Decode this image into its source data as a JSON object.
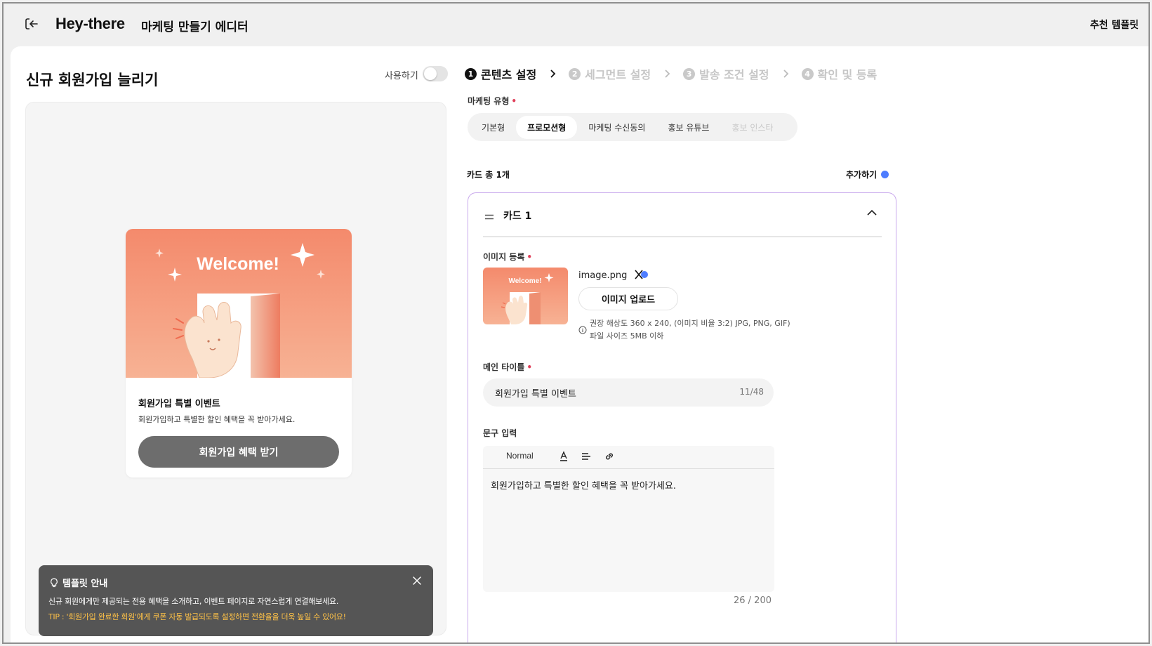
{
  "header": {
    "brand": "Hey-there",
    "subtitle": "마케팅 만들기 에디터",
    "recommended_templates": "추천 템플릿"
  },
  "campaign": {
    "title": "신규 회원가입 늘리기",
    "use_label": "사용하기",
    "enabled": false
  },
  "preview": {
    "banner_text": "Welcome!",
    "card_title": "회원가입 특별 이벤트",
    "card_body": "회원가입하고 특별한 할인 혜택을 꼭 받아가세요.",
    "cta": "회원가입 혜택 받기"
  },
  "guide": {
    "title": "템플릿 안내",
    "text": "신규 회원에게만 제공되는 전용 혜택을 소개하고, 이벤트 페이지로 자연스럽게 연결해보세요.",
    "tip": "TIP : '회원가입 완료한 회원'에게 쿠폰 자동 발급되도록 설정하면 전환율을 더욱 높일 수 있어요!"
  },
  "steps": [
    {
      "num": "1",
      "label": "콘텐츠 설정",
      "active": true
    },
    {
      "num": "2",
      "label": "세그먼트 설정",
      "active": false
    },
    {
      "num": "3",
      "label": "발송 조건 설정",
      "active": false
    },
    {
      "num": "4",
      "label": "확인 및 등록",
      "active": false
    }
  ],
  "marketing_type": {
    "label": "마케팅 유형",
    "required_mark": "•",
    "tabs": [
      "기본형",
      "프로모션형",
      "마케팅 수신동의",
      "홍보 유튜브",
      "홍보 인스타"
    ],
    "selected": "프로모션형"
  },
  "cards": {
    "count_label": "카드 총 1개",
    "add_label": "추가하기"
  },
  "card_editor": {
    "title": "카드 1",
    "image_label": "이미지 등록",
    "file_name": "image.png",
    "upload_button": "이미지 업로드",
    "hint_resolution": "권장 해상도 360 x 240, (이미지 비율 3:2) JPG, PNG, GIF)",
    "hint_size": "파일 사이즈 5MB 이하",
    "main_title_label": "메인 타이틀",
    "main_title_value": "회원가입 특별 이벤트",
    "main_title_count": "11/48",
    "copy_label": "문구 입력",
    "toolbar_format": "Normal",
    "copy_value": "회원가입하고 특별한 할인 혜택을 꼭 받아가세요.",
    "copy_count": "26 / 200"
  },
  "colors": {
    "accent_blue": "#4e7dff",
    "card_border": "#c8a8ec",
    "required_red": "#e0405a",
    "tip_yellow": "#ffc247",
    "banner_orange": "#f48a6c"
  }
}
